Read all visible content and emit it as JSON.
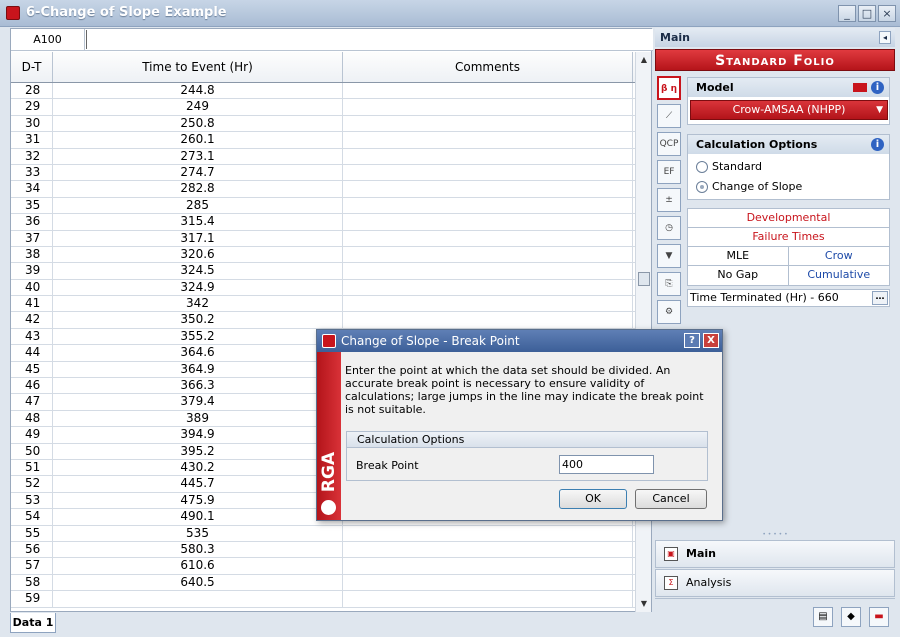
{
  "window": {
    "title": "6-Change of Slope Example"
  },
  "sheet": {
    "cell_ref": "A100",
    "columns": [
      "D-T",
      "Time to Event (Hr)",
      "Comments"
    ],
    "rows": [
      [
        "28",
        "244.8",
        ""
      ],
      [
        "29",
        "249",
        ""
      ],
      [
        "30",
        "250.8",
        ""
      ],
      [
        "31",
        "260.1",
        ""
      ],
      [
        "32",
        "273.1",
        ""
      ],
      [
        "33",
        "274.7",
        ""
      ],
      [
        "34",
        "282.8",
        ""
      ],
      [
        "35",
        "285",
        ""
      ],
      [
        "36",
        "315.4",
        ""
      ],
      [
        "37",
        "317.1",
        ""
      ],
      [
        "38",
        "320.6",
        ""
      ],
      [
        "39",
        "324.5",
        ""
      ],
      [
        "40",
        "324.9",
        ""
      ],
      [
        "41",
        "342",
        ""
      ],
      [
        "42",
        "350.2",
        ""
      ],
      [
        "43",
        "355.2",
        ""
      ],
      [
        "44",
        "364.6",
        ""
      ],
      [
        "45",
        "364.9",
        ""
      ],
      [
        "46",
        "366.3",
        ""
      ],
      [
        "47",
        "379.4",
        ""
      ],
      [
        "48",
        "389",
        ""
      ],
      [
        "49",
        "394.9",
        ""
      ],
      [
        "50",
        "395.2",
        ""
      ],
      [
        "51",
        "430.2",
        ""
      ],
      [
        "52",
        "445.7",
        ""
      ],
      [
        "53",
        "475.9",
        ""
      ],
      [
        "54",
        "490.1",
        ""
      ],
      [
        "55",
        "535",
        ""
      ],
      [
        "56",
        "580.3",
        ""
      ],
      [
        "57",
        "610.6",
        ""
      ],
      [
        "58",
        "640.5",
        ""
      ],
      [
        "59",
        "",
        ""
      ]
    ],
    "tab": "Data 1"
  },
  "panel": {
    "title": "Main",
    "folio": "Standard Folio",
    "model": {
      "header": "Model",
      "selected": "Crow-AMSAA (NHPP)"
    },
    "calc_options": {
      "header": "Calculation Options",
      "options": [
        "Standard",
        "Change of Slope"
      ],
      "selected": "Change of Slope"
    },
    "settings": {
      "type": "Developmental",
      "data": "Failure Times",
      "method": "MLE",
      "method2": "Crow",
      "gap": "No Gap",
      "mode": "Cumulative"
    },
    "termination": "Time Terminated (Hr) - 660",
    "nav": [
      "Main",
      "Analysis"
    ]
  },
  "dialog": {
    "title": "Change of Slope - Break Point",
    "brand": "RGA",
    "message": "Enter the point at which the data set should be divided. An accurate break point is necessary to ensure validity of calculations; large jumps in the line may indicate the break point is not suitable.",
    "group_header": "Calculation Options",
    "field_label": "Break Point",
    "field_value": "400",
    "ok": "OK",
    "cancel": "Cancel",
    "help": "?",
    "close": "X"
  }
}
